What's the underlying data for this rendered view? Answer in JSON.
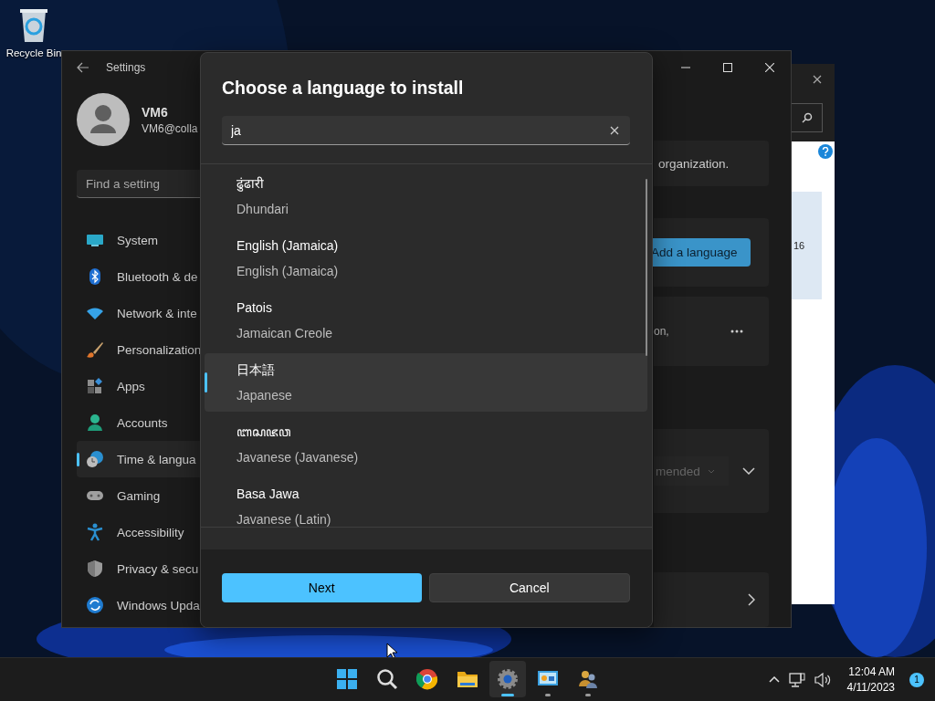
{
  "desktop": {
    "icons": [
      {
        "label": "Recycle Bin"
      }
    ]
  },
  "background_window": {
    "text": "16"
  },
  "settings_window": {
    "title": "Settings",
    "user": {
      "name": "VM6",
      "email": "VM6@colla"
    },
    "search": {
      "placeholder": "Find a setting"
    },
    "nav": [
      {
        "kind": "system",
        "label": "System",
        "selected": false
      },
      {
        "kind": "bluetooth",
        "label": "Bluetooth & de",
        "selected": false
      },
      {
        "kind": "network",
        "label": "Network & inte",
        "selected": false
      },
      {
        "kind": "personalization",
        "label": "Personalization",
        "selected": false
      },
      {
        "kind": "apps",
        "label": "Apps",
        "selected": false
      },
      {
        "kind": "accounts",
        "label": "Accounts",
        "selected": false
      },
      {
        "kind": "time",
        "label": "Time & langua",
        "selected": true
      },
      {
        "kind": "gaming",
        "label": "Gaming",
        "selected": false
      },
      {
        "kind": "accessibility",
        "label": "Accessibility",
        "selected": false
      },
      {
        "kind": "privacy",
        "label": "Privacy & secu",
        "selected": false
      },
      {
        "kind": "update",
        "label": "Windows Upda",
        "selected": false
      }
    ],
    "cards": [
      {
        "kind": "text",
        "text": "organization."
      },
      {
        "kind": "button",
        "label": "Add a language"
      },
      {
        "kind": "more",
        "text": "on,"
      },
      {
        "kind": "dropdown",
        "value": "mended"
      },
      {
        "kind": "link"
      }
    ]
  },
  "dialog": {
    "title": "Choose a language to install",
    "search": {
      "value": "ja"
    },
    "languages": [
      {
        "native": "ढुंढारी",
        "english": "Dhundari",
        "selected": false
      },
      {
        "native": "English (Jamaica)",
        "english": "English (Jamaica)",
        "selected": false
      },
      {
        "native": "Patois",
        "english": "Jamaican Creole",
        "selected": false
      },
      {
        "native": "日本語",
        "english": "Japanese",
        "selected": true
      },
      {
        "native": "ꦧꦱꦗꦮ",
        "english": "Javanese (Javanese)",
        "selected": false
      },
      {
        "native": "Basa Jawa",
        "english": "Javanese (Latin)",
        "selected": false
      }
    ],
    "buttons": [
      {
        "kind": "primary",
        "label": "Next"
      },
      {
        "kind": "secondary",
        "label": "Cancel"
      }
    ]
  },
  "taskbar": {
    "apps": [
      {
        "kind": "start",
        "running": false,
        "active": false
      },
      {
        "kind": "search",
        "running": false,
        "active": false
      },
      {
        "kind": "browser",
        "running": false,
        "active": false
      },
      {
        "kind": "folder",
        "running": false,
        "active": false
      },
      {
        "kind": "settings",
        "running": true,
        "active": true
      },
      {
        "kind": "remote",
        "running": true,
        "active": false
      },
      {
        "kind": "users",
        "running": true,
        "active": false
      }
    ],
    "clock": {
      "time": "12:04 AM",
      "date": "4/11/2023"
    },
    "notifications": "1"
  }
}
